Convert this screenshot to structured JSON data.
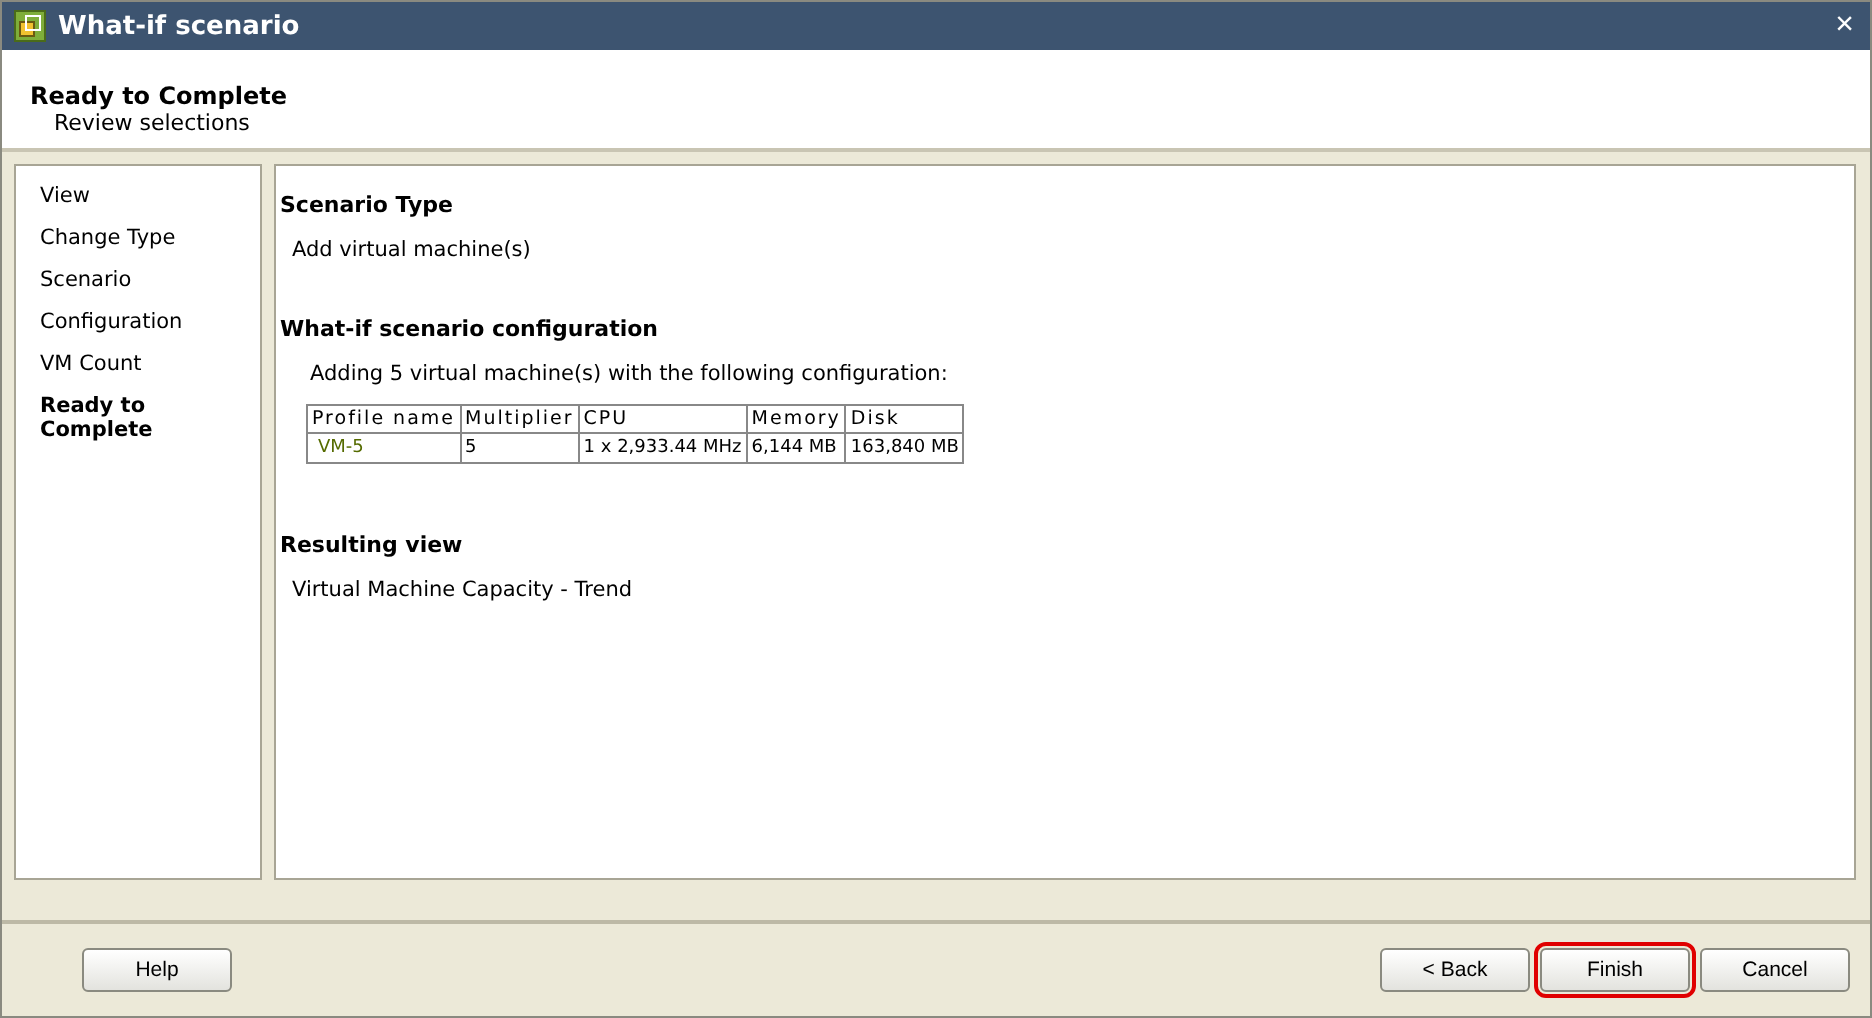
{
  "window": {
    "title": "What-if scenario",
    "close": "×"
  },
  "header": {
    "title": "Ready to Complete",
    "subtitle": "Review selections"
  },
  "sidebar": {
    "items": [
      {
        "label": "View",
        "selected": false
      },
      {
        "label": "Change Type",
        "selected": false
      },
      {
        "label": "Scenario",
        "selected": false
      },
      {
        "label": "Configuration",
        "selected": false
      },
      {
        "label": "VM Count",
        "selected": false
      },
      {
        "label": "Ready to Complete",
        "selected": true
      }
    ]
  },
  "content": {
    "sections": [
      {
        "heading": "Scenario Type",
        "text": "Add virtual machine(s)"
      },
      {
        "heading": "What-if scenario configuration",
        "text": "Adding 5 virtual machine(s) with the following configuration:",
        "table": {
          "columns": [
            "Profile name",
            "Multiplier",
            "CPU",
            "Memory",
            "Disk"
          ],
          "rows": [
            [
              "VM-5",
              "5",
              "1 x 2,933.44 MHz",
              "6,144 MB",
              "163,840 MB"
            ]
          ]
        }
      },
      {
        "heading": "Resulting view",
        "text": "Virtual Machine Capacity - Trend"
      }
    ]
  },
  "footer": {
    "left_buttons": [
      {
        "label": "Help",
        "highlighted": false
      }
    ],
    "right_buttons": [
      {
        "label": "< Back",
        "highlighted": false
      },
      {
        "label": "Finish",
        "highlighted": true
      },
      {
        "label": "Cancel",
        "highlighted": false
      }
    ]
  }
}
